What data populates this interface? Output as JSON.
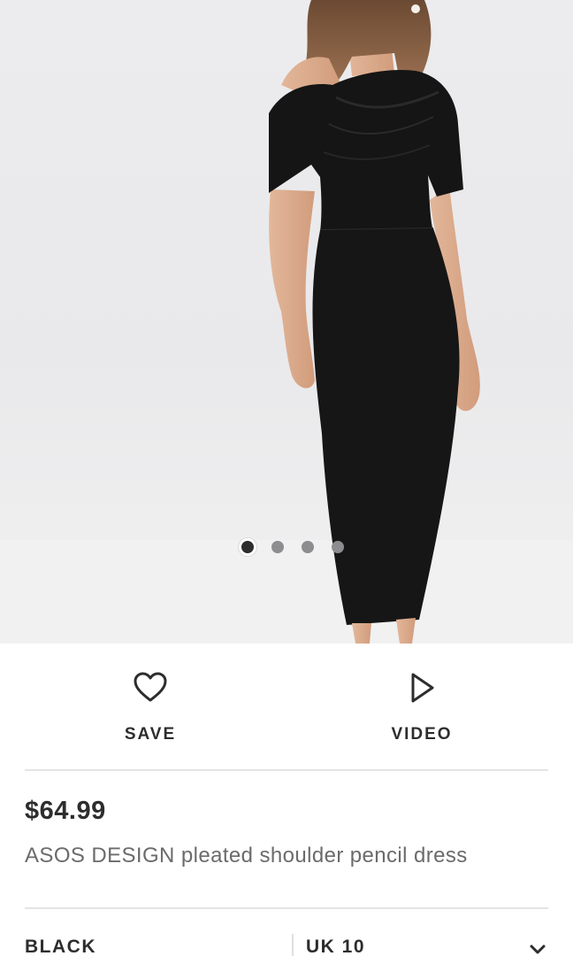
{
  "product_image": {
    "carousel": {
      "count": 4,
      "active_index": 0
    }
  },
  "actions": {
    "save_label": "SAVE",
    "save_icon": "heart-outline-icon",
    "video_label": "VIDEO",
    "video_icon": "play-outline-icon"
  },
  "product": {
    "price": "$64.99",
    "title": "ASOS DESIGN pleated shoulder pencil dress"
  },
  "selectors": {
    "colour_value": "BLACK",
    "size_value": "UK 10",
    "size_dropdown_icon": "chevron-down-icon"
  },
  "colors": {
    "text_primary": "#2d2d2d",
    "text_secondary": "#6b6b6b",
    "divider": "#e4e4e4",
    "dot_inactive": "#8d8d8f",
    "dot_active": "#2d2d2d"
  }
}
